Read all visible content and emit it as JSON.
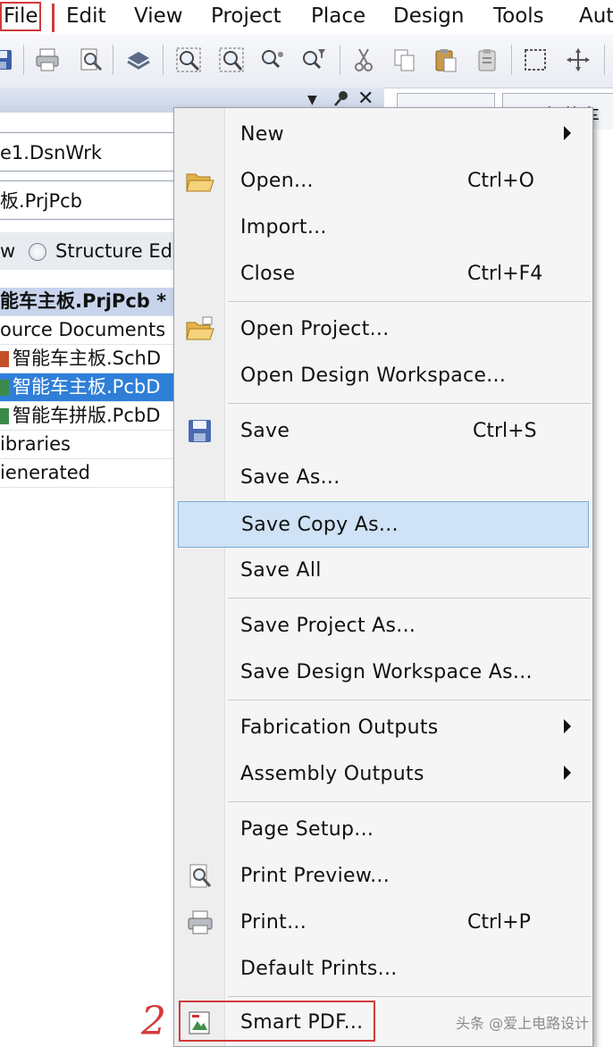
{
  "menubar": {
    "items": [
      "File",
      "Edit",
      "View",
      "Project",
      "Place",
      "Design",
      "Tools",
      "Aut"
    ]
  },
  "toolbar": {
    "icons": [
      "save-icon",
      "print-icon",
      "print-preview-icon",
      "layer-stack-icon",
      "zoom-fit-icon",
      "zoom-area-icon",
      "zoom-selected-icon",
      "zoom-filter-icon",
      "cut-icon",
      "copy-icon",
      "paste-icon",
      "paste-special-icon",
      "select-rect-icon",
      "move-icon"
    ]
  },
  "panel": {
    "workspace": "e1.DsnWrk",
    "project": "板.PrjPcb",
    "view_mode": "w",
    "structure_editor": "Structure Edito",
    "tree": [
      {
        "text": "能车主板.PrjPcb *",
        "state": "selected"
      },
      {
        "text": "ource Documents",
        "state": "normal"
      },
      {
        "text": "智能车主板.SchD",
        "state": "normal"
      },
      {
        "text": "智能车主板.PcbD",
        "state": "highlighted"
      },
      {
        "text": "智能车拼版.PcbD",
        "state": "normal"
      },
      {
        "text": "ibraries",
        "state": "normal"
      },
      {
        "text": "ienerated",
        "state": "normal"
      }
    ],
    "right_tab": "智能车"
  },
  "file_menu": {
    "items": [
      {
        "label": "New",
        "shortcut": "",
        "submenu": true,
        "icon": ""
      },
      {
        "label": "Open...",
        "shortcut": "Ctrl+O",
        "submenu": false,
        "icon": "open-folder-icon"
      },
      {
        "label": "Import...",
        "shortcut": "",
        "submenu": false,
        "icon": ""
      },
      {
        "label": "Close",
        "shortcut": "Ctrl+F4",
        "submenu": false,
        "icon": ""
      },
      {
        "label": "Open Project...",
        "shortcut": "",
        "submenu": false,
        "icon": "open-project-icon"
      },
      {
        "label": "Open Design Workspace...",
        "shortcut": "",
        "submenu": false,
        "icon": ""
      },
      {
        "label": "Save",
        "shortcut": "Ctrl+S",
        "submenu": false,
        "icon": "save-disk-icon"
      },
      {
        "label": "Save As...",
        "shortcut": "",
        "submenu": false,
        "icon": ""
      },
      {
        "label": "Save Copy As...",
        "shortcut": "",
        "submenu": false,
        "icon": "",
        "hover": true
      },
      {
        "label": "Save All",
        "shortcut": "",
        "submenu": false,
        "icon": ""
      },
      {
        "label": "Save Project As...",
        "shortcut": "",
        "submenu": false,
        "icon": ""
      },
      {
        "label": "Save Design Workspace As...",
        "shortcut": "",
        "submenu": false,
        "icon": ""
      },
      {
        "label": "Fabrication Outputs",
        "shortcut": "",
        "submenu": true,
        "icon": ""
      },
      {
        "label": "Assembly Outputs",
        "shortcut": "",
        "submenu": true,
        "icon": ""
      },
      {
        "label": "Page Setup...",
        "shortcut": "",
        "submenu": false,
        "icon": ""
      },
      {
        "label": "Print Preview...",
        "shortcut": "",
        "submenu": false,
        "icon": "print-preview-icon"
      },
      {
        "label": "Print...",
        "shortcut": "Ctrl+P",
        "submenu": false,
        "icon": "printer-icon"
      },
      {
        "label": "Default Prints...",
        "shortcut": "",
        "submenu": false,
        "icon": ""
      },
      {
        "label": "Smart PDF...",
        "shortcut": "",
        "submenu": false,
        "icon": "smart-pdf-icon"
      }
    ]
  },
  "annotations": {
    "step_number": "2",
    "watermark": "头条 @爱上电路设计",
    "highlight_color": "#d23a3a"
  }
}
